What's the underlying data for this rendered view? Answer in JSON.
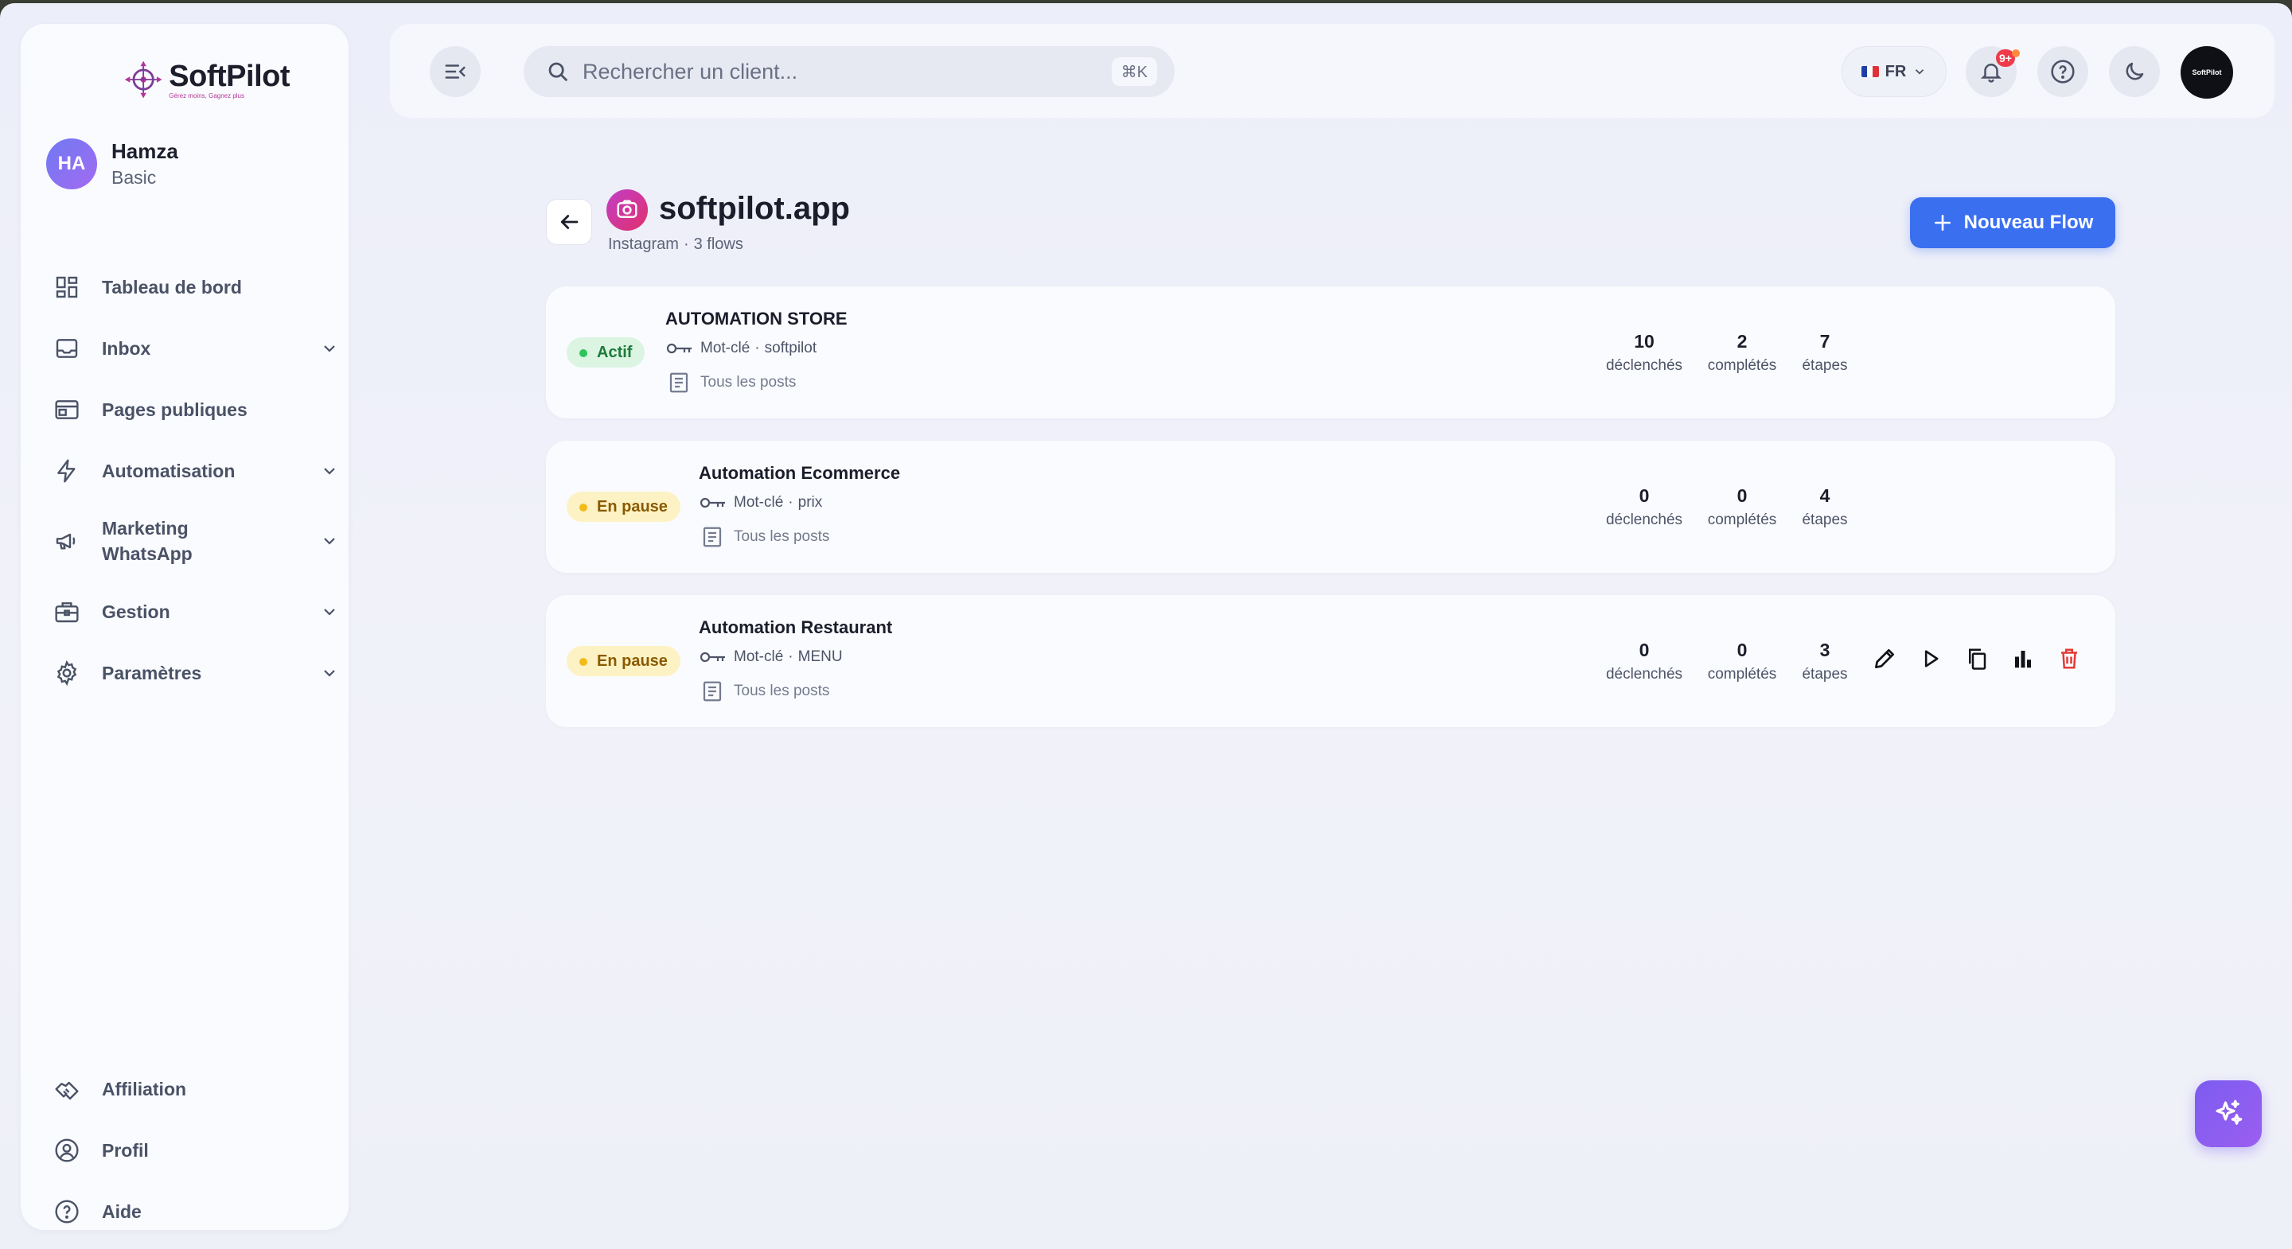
{
  "brand": {
    "name": "SoftPilot",
    "tagline": "Gérez moins, Gagnez plus"
  },
  "user": {
    "initials": "HA",
    "name": "Hamza",
    "plan": "Basic"
  },
  "sidebar": {
    "items": [
      {
        "label": "Tableau de bord",
        "icon": "dashboard-icon"
      },
      {
        "label": "Inbox",
        "icon": "inbox-icon"
      },
      {
        "label": "Pages publiques",
        "icon": "pages-icon"
      },
      {
        "label": "Automatisation",
        "icon": "bolt-icon"
      },
      {
        "label": "Marketing WhatsApp",
        "icon": "megaphone-icon"
      },
      {
        "label": "Gestion",
        "icon": "briefcase-icon"
      },
      {
        "label": "Paramètres",
        "icon": "gear-icon"
      }
    ],
    "bottom": [
      {
        "label": "Affiliation",
        "icon": "handshake-icon"
      },
      {
        "label": "Profil",
        "icon": "user-circle-icon"
      },
      {
        "label": "Aide",
        "icon": "help-icon"
      }
    ]
  },
  "header": {
    "search_placeholder": "Rechercher un client...",
    "search_shortcut": "⌘K",
    "language": "FR",
    "notif_count": "9+",
    "profile_label": "SoftPilot"
  },
  "page": {
    "title": "softpilot.app",
    "platform": "Instagram",
    "flow_count": "3 flows",
    "new_flow_label": "Nouveau Flow"
  },
  "flows": [
    {
      "status": "Actif",
      "name": "AUTOMATION STORE",
      "trigger_type": "Mot-clé",
      "keyword": "softpilot",
      "scope": "Tous les posts",
      "triggered": "10",
      "completed": "2",
      "steps": "7"
    },
    {
      "status": "En pause",
      "name": "Automation Ecommerce",
      "trigger_type": "Mot-clé",
      "keyword": "prix",
      "scope": "Tous les posts",
      "triggered": "0",
      "completed": "0",
      "steps": "4"
    },
    {
      "status": "En pause",
      "name": "Automation Restaurant",
      "trigger_type": "Mot-clé",
      "keyword": "MENU",
      "scope": "Tous les posts",
      "triggered": "0",
      "completed": "0",
      "steps": "3"
    }
  ],
  "stat_labels": {
    "triggered": "déclenchés",
    "completed": "complétés",
    "steps": "étapes"
  },
  "colors": {
    "accent": "#3a6ff0",
    "active": "#2ec45a",
    "paused": "#f1bc1a",
    "danger": "#e53935",
    "ai": "#7c5cf0"
  }
}
